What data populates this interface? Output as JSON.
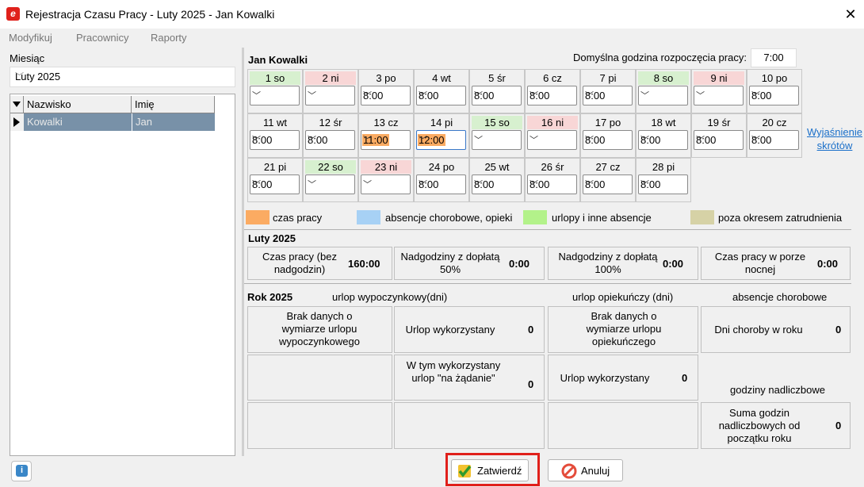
{
  "window": {
    "title": "Rejestracja Czasu Pracy - Luty 2025 - Jan Kowalki",
    "close_glyph": "✕"
  },
  "menu": [
    "Modyfikuj",
    "Pracownicy",
    "Raporty"
  ],
  "left": {
    "month_label": "Miesiąc",
    "month_value": "Luty 2025",
    "columns": [
      "Nazwisko",
      "Imię"
    ],
    "rows": [
      {
        "surname": "Kowalki",
        "name": "Jan"
      }
    ]
  },
  "employee": "Jan Kowalki",
  "default_start": {
    "label": "Domyślna godzina rozpoczęcia pracy:",
    "value": "7:00"
  },
  "help_link": [
    "Wyjaśnienie",
    "skrótów"
  ],
  "days": [
    {
      "label": "1 so",
      "value": "",
      "day": "green"
    },
    {
      "label": "2 ni",
      "value": "",
      "day": "red"
    },
    {
      "label": "3 po",
      "value": "8:00"
    },
    {
      "label": "4 wt",
      "value": "8:00"
    },
    {
      "label": "5 śr",
      "value": "8:00"
    },
    {
      "label": "6 cz",
      "value": "8:00"
    },
    {
      "label": "7 pi",
      "value": "8:00"
    },
    {
      "label": "8 so",
      "value": "",
      "day": "green"
    },
    {
      "label": "9 ni",
      "value": "",
      "day": "red"
    },
    {
      "label": "10 po",
      "value": "8:00"
    },
    {
      "label": "11 wt",
      "value": "8:00"
    },
    {
      "label": "12 śr",
      "value": "8:00"
    },
    {
      "label": "13 cz",
      "value": "11:00",
      "hl": "orange"
    },
    {
      "label": "14 pi",
      "value": "12:00",
      "hl": "orange",
      "focused": true
    },
    {
      "label": "15 so",
      "value": "",
      "day": "green"
    },
    {
      "label": "16 ni",
      "value": "",
      "day": "red"
    },
    {
      "label": "17 po",
      "value": "8:00"
    },
    {
      "label": "18 wt",
      "value": "8:00"
    },
    {
      "label": "19 śr",
      "value": "8:00"
    },
    {
      "label": "20 cz",
      "value": "8:00"
    },
    {
      "label": "21 pi",
      "value": "8:00"
    },
    {
      "label": "22 so",
      "value": "",
      "day": "green"
    },
    {
      "label": "23 ni",
      "value": "",
      "day": "red"
    },
    {
      "label": "24 po",
      "value": "8:00"
    },
    {
      "label": "25 wt",
      "value": "8:00"
    },
    {
      "label": "26 śr",
      "value": "8:00"
    },
    {
      "label": "27 cz",
      "value": "8:00"
    },
    {
      "label": "28 pi",
      "value": "8:00"
    }
  ],
  "legend": [
    {
      "label": "czas pracy",
      "color": "#fbab62"
    },
    {
      "label": "absencje chorobowe, opieki",
      "color": "#a7d1f5"
    },
    {
      "label": "urlopy i inne absencje",
      "color": "#b3f28a"
    },
    {
      "label": "poza okresem zatrudnienia",
      "color": "#d6d2a6"
    }
  ],
  "month_summary": {
    "title": "Luty 2025",
    "items": [
      {
        "label": "Czas pracy (bez nadgodzin)",
        "value": "160:00"
      },
      {
        "label": "Nadgodziny z dopłatą 50%",
        "value": "0:00"
      },
      {
        "label": "Nadgodziny z dopłatą 100%",
        "value": "0:00"
      },
      {
        "label": "Czas pracy w porze nocnej",
        "value": "0:00"
      }
    ]
  },
  "year_summary": {
    "title": "Rok 2025",
    "headers": [
      "urlop wypoczynkowy(dni)",
      "urlop opiekuńczy (dni)",
      "absencje chorobowe"
    ],
    "no_leave_data": "Brak danych o wymiarze urlopu wypoczynkowego",
    "leave_used": {
      "label": "Urlop wykorzystany",
      "value": "0"
    },
    "on_demand": {
      "label": "W tym wykorzystany urlop \"na żądanie\"",
      "value": "0"
    },
    "no_care_data": "Brak danych o wymiarze urlopu opiekuńczego",
    "care_used": {
      "label": "Urlop wykorzystany",
      "value": "0"
    },
    "sick_days": {
      "label": "Dni choroby w roku",
      "value": "0"
    },
    "overtime_header": "godziny nadliczbowe",
    "overtime_sum": {
      "label": "Suma godzin nadliczbowych od początku roku",
      "value": "0"
    }
  },
  "buttons": {
    "confirm": "Zatwierdź",
    "cancel": "Anuluj"
  }
}
